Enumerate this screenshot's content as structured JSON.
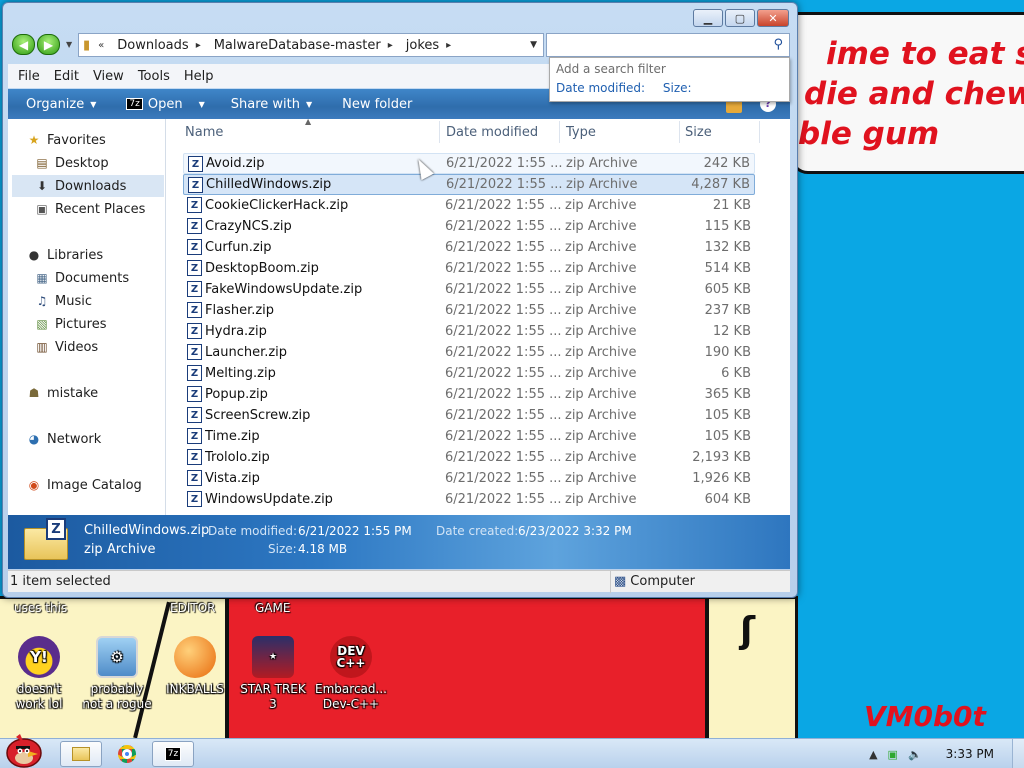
{
  "window": {
    "address_crumbs": [
      "Downloads",
      "MalwareDatabase-master",
      "jokes"
    ],
    "search_placeholder": "",
    "search_filter": {
      "hint": "Add a search filter",
      "options": [
        "Date modified:",
        "Size:"
      ]
    },
    "menu": [
      "File",
      "Edit",
      "View",
      "Tools",
      "Help"
    ],
    "commands": {
      "organize": "Organize",
      "open": "Open",
      "open_badge": "7z",
      "share": "Share with",
      "new_folder": "New folder"
    },
    "nav": {
      "favorites": "Favorites",
      "desktop": "Desktop",
      "downloads": "Downloads",
      "recent": "Recent Places",
      "libraries": "Libraries",
      "documents": "Documents",
      "music": "Music",
      "pictures": "Pictures",
      "videos": "Videos",
      "mistake": "mistake",
      "network": "Network",
      "image_catalog": "Image Catalog"
    },
    "columns": {
      "name": "Name",
      "date": "Date modified",
      "type": "Type",
      "size": "Size"
    },
    "files": [
      {
        "name": "Avoid.zip",
        "date": "6/21/2022 1:55 ...",
        "type": "zip Archive",
        "size": "242 KB"
      },
      {
        "name": "ChilledWindows.zip",
        "date": "6/21/2022 1:55 ...",
        "type": "zip Archive",
        "size": "4,287 KB"
      },
      {
        "name": "CookieClickerHack.zip",
        "date": "6/21/2022 1:55 ...",
        "type": "zip Archive",
        "size": "21 KB"
      },
      {
        "name": "CrazyNCS.zip",
        "date": "6/21/2022 1:55 ...",
        "type": "zip Archive",
        "size": "115 KB"
      },
      {
        "name": "Curfun.zip",
        "date": "6/21/2022 1:55 ...",
        "type": "zip Archive",
        "size": "132 KB"
      },
      {
        "name": "DesktopBoom.zip",
        "date": "6/21/2022 1:55 ...",
        "type": "zip Archive",
        "size": "514 KB"
      },
      {
        "name": "FakeWindowsUpdate.zip",
        "date": "6/21/2022 1:55 ...",
        "type": "zip Archive",
        "size": "605 KB"
      },
      {
        "name": "Flasher.zip",
        "date": "6/21/2022 1:55 ...",
        "type": "zip Archive",
        "size": "237 KB"
      },
      {
        "name": "Hydra.zip",
        "date": "6/21/2022 1:55 ...",
        "type": "zip Archive",
        "size": "12 KB"
      },
      {
        "name": "Launcher.zip",
        "date": "6/21/2022 1:55 ...",
        "type": "zip Archive",
        "size": "190 KB"
      },
      {
        "name": "Melting.zip",
        "date": "6/21/2022 1:55 ...",
        "type": "zip Archive",
        "size": "6 KB"
      },
      {
        "name": "Popup.zip",
        "date": "6/21/2022 1:55 ...",
        "type": "zip Archive",
        "size": "365 KB"
      },
      {
        "name": "ScreenScrew.zip",
        "date": "6/21/2022 1:55 ...",
        "type": "zip Archive",
        "size": "105 KB"
      },
      {
        "name": "Time.zip",
        "date": "6/21/2022 1:55 ...",
        "type": "zip Archive",
        "size": "105 KB"
      },
      {
        "name": "Trololo.zip",
        "date": "6/21/2022 1:55 ...",
        "type": "zip Archive",
        "size": "2,193 KB"
      },
      {
        "name": "Vista.zip",
        "date": "6/21/2022 1:55 ...",
        "type": "zip Archive",
        "size": "1,926 KB"
      },
      {
        "name": "WindowsUpdate.zip",
        "date": "6/21/2022 1:55 ...",
        "type": "zip Archive",
        "size": "604 KB"
      }
    ],
    "details": {
      "name": "ChilledWindows.zip",
      "type": "zip Archive",
      "modified_label": "Date modified:",
      "modified_value": "6/21/2022 1:55 PM",
      "created_label": "Date created:",
      "created_value": "6/23/2022 3:32 PM",
      "size_label": "Size:",
      "size_value": "4.18 MB"
    },
    "status": {
      "selected": "1 item selected",
      "location": "Computer"
    }
  },
  "desktop": {
    "scrawl_lines": [
      "ime to eat shit",
      "die and chew",
      "ble gum"
    ],
    "signature": "VM0b0t",
    "labels": {
      "uses_this": "uses this",
      "editor": "EDITOR",
      "game": "GAME"
    },
    "icons": [
      {
        "label": "doesn't work lol",
        "icon": "yahoo-messenger-icon"
      },
      {
        "label": "probably not a rogue",
        "icon": "gear-monitor-icon"
      },
      {
        "label": "INKBALLS",
        "icon": "inkball-icon"
      },
      {
        "label": "STAR TREK 3",
        "icon": "star-trek-icon"
      },
      {
        "label": "Embarcad... Dev-C++",
        "icon": "dev-cpp-icon"
      }
    ]
  },
  "taskbar": {
    "clock": "3:33 PM",
    "items": [
      "explorer",
      "chrome",
      "7zip"
    ]
  },
  "colors": {
    "desktop_bg": "#0aa7e4",
    "accent_blue": "#2f6dac",
    "scrawl_red": "#e0121e"
  }
}
